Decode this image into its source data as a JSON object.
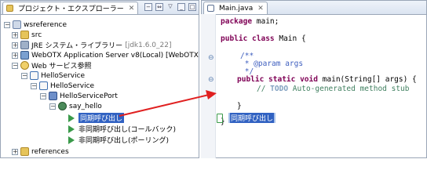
{
  "explorer": {
    "tab_title": "プロジェクト・エクスプローラー",
    "close": "✕",
    "tree": {
      "project": "wsreference",
      "src": "src",
      "jre_label": "JRE システム・ライブラリー",
      "jre_version": "[jdk1.6.0_22]",
      "server_label": "WebOTX Application Server v8(Local) [WebOTX",
      "web_services": "Web サービス参照",
      "service_root": "HelloService",
      "service": "HelloService",
      "port": "HelloServicePort",
      "operation": "say_hello",
      "ops": [
        "同期呼び出し",
        "非同期呼び出し(コールバック)",
        "非同期呼び出し(ポーリング)"
      ],
      "references": "references"
    }
  },
  "editor": {
    "tab_title": "Main.java",
    "close": "✕",
    "lines": {
      "pkg_kw": "package",
      "pkg_name": " main;",
      "class_decl_kw": "public class",
      "class_decl_rest": " Main {",
      "jd_open": "/**",
      "jd_param": " * @param args",
      "jd_close": " */",
      "main_kw": "public static void",
      "main_rest": " main(String[] args) {",
      "todo_comment_prefix": "// ",
      "todo_word": "TODO",
      "todo_rest": " Auto-generated method stub",
      "brace_inner": "}",
      "brace_outer": "}"
    },
    "dropped_label": "同期呼び出し"
  },
  "colors": {
    "selection": "#3162c2",
    "arrow": "#e02020",
    "keyword": "#7f0055",
    "comment": "#3f7f5f"
  }
}
